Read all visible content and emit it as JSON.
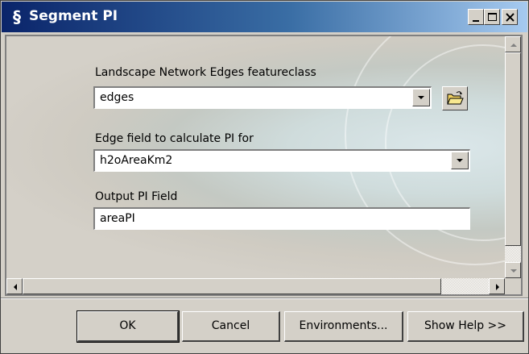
{
  "window": {
    "title": "Segment PI",
    "icon": "script-icon"
  },
  "form": {
    "edges_label": "Landscape Network Edges featureclass",
    "edges_value": "edges",
    "edge_field_label": "Edge field to calculate PI for",
    "edge_field_value": "h2oAreaKm2",
    "output_label": "Output PI Field",
    "output_value": "areaPI"
  },
  "buttons": {
    "ok": "OK",
    "cancel": "Cancel",
    "environments": "Environments...",
    "show_help": "Show Help >>"
  },
  "icons": {
    "minimize": "minimize-icon",
    "maximize": "maximize-icon",
    "close": "close-icon",
    "browse": "open-folder-icon"
  },
  "colors": {
    "titlebar_start": "#0a246a",
    "titlebar_end": "#a6caf0",
    "face": "#d4d0c8"
  }
}
